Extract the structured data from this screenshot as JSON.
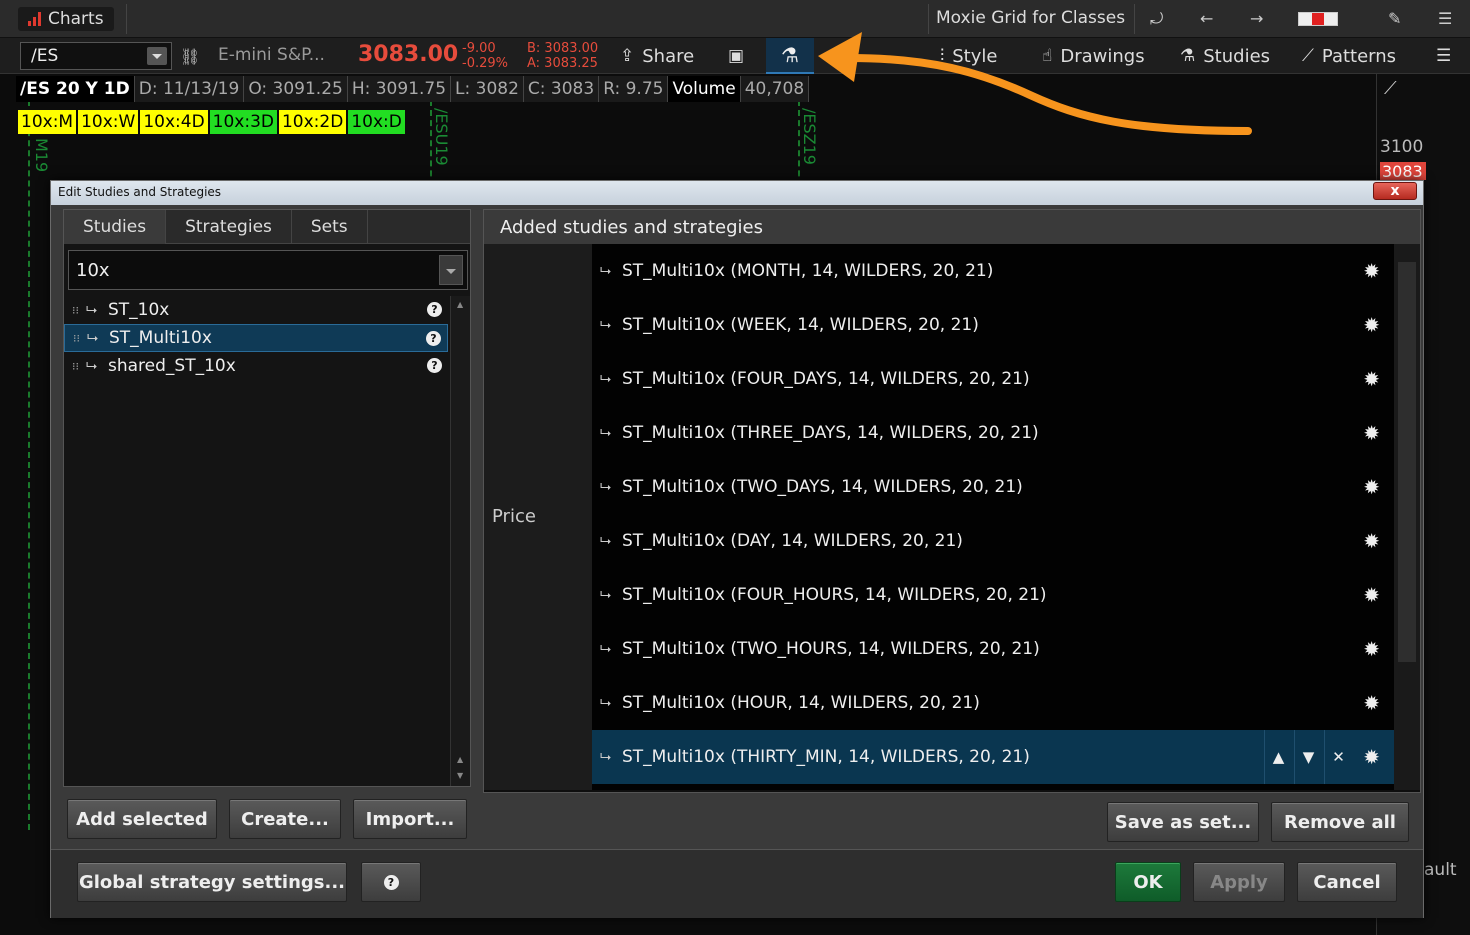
{
  "titlebar": {
    "app_tab": "Charts",
    "grid_name": "Moxie Grid for Classes"
  },
  "symbol_bar": {
    "symbol": "/ES",
    "description": "E-mini S&P...",
    "price": "3083.00",
    "change": "-9.00",
    "change_pct": "-0.29%",
    "bid": "B: 3083.00",
    "ask": "A: 3083.25",
    "share_label": "Share",
    "style_label": "Style",
    "drawings_label": "Drawings",
    "studies_label": "Studies",
    "patterns_label": "Patterns"
  },
  "info_bar": {
    "symbol_period": "/ES 20 Y 1D",
    "date": "D: 11/13/19",
    "open": "O: 3091.25",
    "high": "H: 3091.75",
    "low": "L: 3082",
    "close": "C: 3083",
    "range": "R: 9.75",
    "volume_label": "Volume",
    "volume_value": "40,708"
  },
  "study_labels": [
    {
      "text": "10x:M",
      "color": "#ffff00"
    },
    {
      "text": "10x:W",
      "color": "#ffff00"
    },
    {
      "text": "10x:4D",
      "color": "#ffff00"
    },
    {
      "text": "10x:3D",
      "color": "#22dd22"
    },
    {
      "text": "10x:2D",
      "color": "#ffff00"
    },
    {
      "text": "10x:D",
      "color": "#22dd22"
    }
  ],
  "chart": {
    "expiry_labels": [
      "M19",
      "/ESU19",
      "/ESZ19"
    ],
    "price_3100": "3100",
    "price_tag": "3083",
    "corner_text": "ault"
  },
  "dialog": {
    "title": "Edit Studies and Strategies",
    "close_label": "x",
    "tabs": [
      "Studies",
      "Strategies",
      "Sets"
    ],
    "search_value": "10x",
    "studies": [
      {
        "name": "ST_10x",
        "selected": false
      },
      {
        "name": "ST_Multi10x",
        "selected": true
      },
      {
        "name": "shared_ST_10x",
        "selected": false
      }
    ],
    "help_glyph": "?",
    "added_header": "Added studies and strategies",
    "group_label": "Price",
    "added": [
      "ST_Multi10x (MONTH, 14, WILDERS, 20, 21)",
      "ST_Multi10x (WEEK, 14, WILDERS, 20, 21)",
      "ST_Multi10x (FOUR_DAYS, 14, WILDERS, 20, 21)",
      "ST_Multi10x (THREE_DAYS, 14, WILDERS, 20, 21)",
      "ST_Multi10x (TWO_DAYS, 14, WILDERS, 20, 21)",
      "ST_Multi10x (DAY, 14, WILDERS, 20, 21)",
      "ST_Multi10x (FOUR_HOURS, 14, WILDERS, 20, 21)",
      "ST_Multi10x (TWO_HOURS, 14, WILDERS, 20, 21)",
      "ST_Multi10x (HOUR, 14, WILDERS, 20, 21)",
      "ST_Multi10x (THIRTY_MIN, 14, WILDERS, 20, 21)"
    ],
    "buttons": {
      "add_selected": "Add selected",
      "create": "Create...",
      "import": "Import...",
      "save_as_set": "Save as set...",
      "remove_all": "Remove all",
      "global_settings": "Global strategy settings...",
      "ok": "OK",
      "apply": "Apply",
      "cancel": "Cancel"
    }
  },
  "colors": {
    "accent_orange": "#f7941d",
    "price_red": "#e74c3c",
    "selection_blue": "#0f3a56",
    "ok_green": "#1d7a3b"
  }
}
